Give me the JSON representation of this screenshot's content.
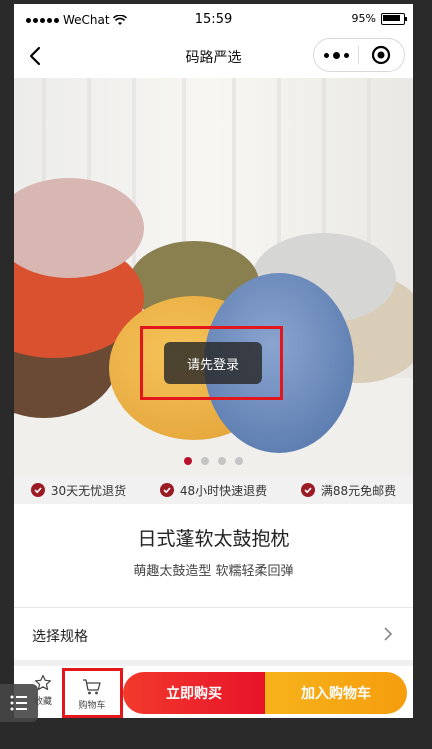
{
  "status_bar": {
    "carrier": "WeChat",
    "time": "15:59",
    "battery": "95%"
  },
  "nav": {
    "title": "码路严选"
  },
  "toast": {
    "text": "请先登录"
  },
  "carousel": {
    "page_count": 4,
    "active_index": 0
  },
  "guarantees": [
    "30天无忧退货",
    "48小时快速退费",
    "满88元免邮费"
  ],
  "product": {
    "title": "日式蓬软太鼓抱枕",
    "subtitle": "萌趣太鼓造型 软糯轻柔回弹"
  },
  "spec": {
    "label": "选择规格"
  },
  "bottom_bar": {
    "favorite_label": "收藏",
    "cart_label": "购物车",
    "buy_now_label": "立即购买",
    "add_to_cart_label": "加入购物车"
  },
  "colors": {
    "highlight": "#e3161c",
    "buy_now": "#e8132a",
    "add_to_cart": "#f59d0d",
    "accent": "#9a1b24"
  },
  "icons": [
    "wifi-icon",
    "back-icon",
    "more-icon",
    "close-circle-icon",
    "check-icon",
    "chevron-right-icon",
    "star-icon",
    "cart-icon",
    "menu-icon"
  ]
}
